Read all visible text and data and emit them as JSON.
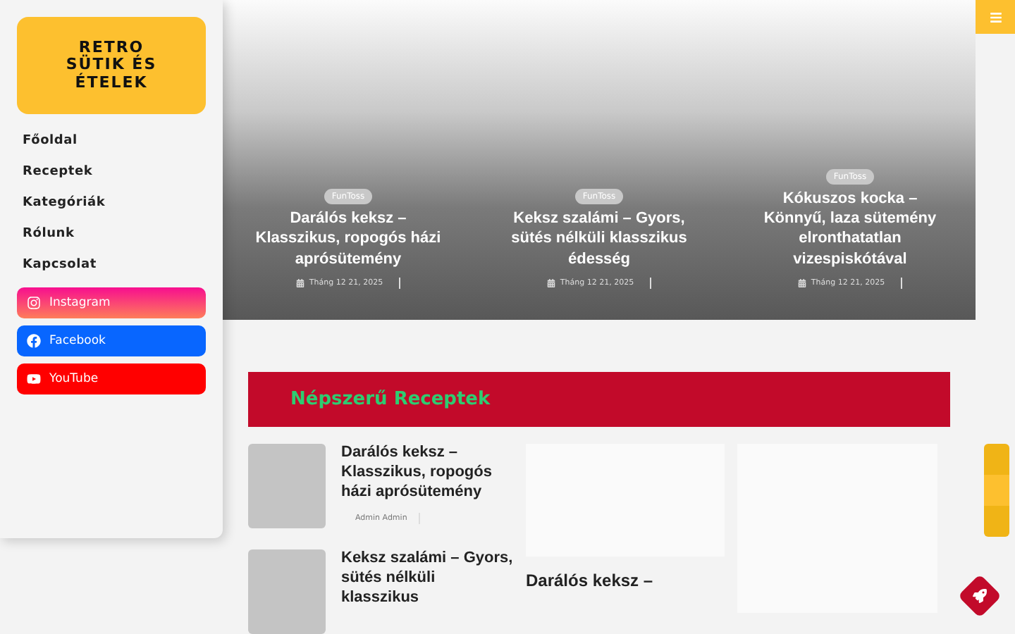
{
  "logo": {
    "text": "RETRO SÜTIK ÉS ÉTELEK"
  },
  "nav": [
    {
      "label": "Főoldal"
    },
    {
      "label": "Receptek"
    },
    {
      "label": "Kategóriák"
    },
    {
      "label": "Rólunk"
    },
    {
      "label": "Kapcsolat"
    }
  ],
  "social": [
    {
      "kind": "instagram",
      "label": "Instagram"
    },
    {
      "kind": "facebook",
      "label": "Facebook"
    },
    {
      "kind": "youtube",
      "label": "YouTube"
    }
  ],
  "slides": [
    {
      "tag": "FunToss",
      "title": "Darálós keksz – Klasszikus, ropogós házi aprósütemény",
      "date": "Tháng 12 21, 2025"
    },
    {
      "tag": "FunToss",
      "title": "Keksz szalámi – Gyors, sütés nélküli klasszikus édesség",
      "date": "Tháng 12 21, 2025"
    },
    {
      "tag": "FunToss",
      "title": "Kókuszos kocka – Könnyű, laza sütemény elronthatatlan vizespiskótával",
      "date": "Tháng 12 21, 2025"
    }
  ],
  "popular": {
    "heading": "Népszerű Receptek",
    "list": [
      {
        "title": "Darálós keksz – Klasszikus, ropogós házi aprósütemény",
        "author": "Admin Admin"
      },
      {
        "title": "Keksz szalámi – Gyors, sütés nélküli klasszikus"
      }
    ],
    "card": {
      "title": "Darálós keksz –"
    }
  }
}
